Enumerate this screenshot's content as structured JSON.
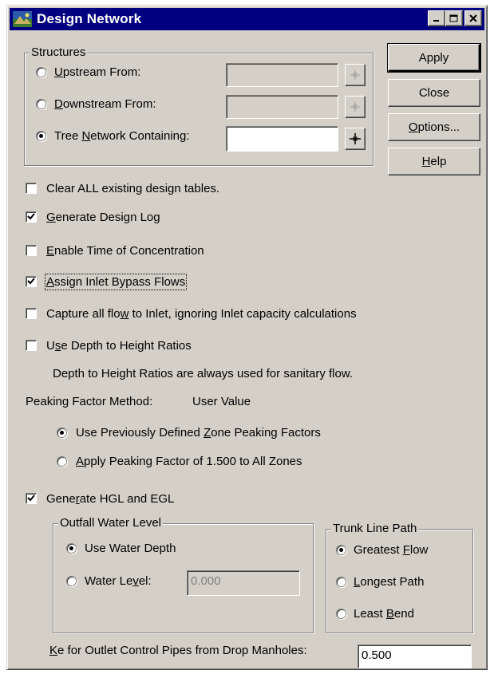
{
  "window": {
    "title": "Design Network"
  },
  "structures": {
    "group_label": "Structures",
    "upstream_label": "Upstream From:",
    "downstream_label": "Downstream From:",
    "tree_label": "Tree Network Containing:",
    "upstream_value": "",
    "downstream_value": "",
    "tree_value": "",
    "selected": "tree"
  },
  "buttons": {
    "apply": "Apply",
    "close": "Close",
    "options": "Options...",
    "help": "Help"
  },
  "options": {
    "clear_tables": {
      "label": "Clear ALL existing design tables.",
      "checked": false
    },
    "design_log": {
      "label": "Generate Design Log",
      "checked": true
    },
    "time_of_conc": {
      "label": "Enable Time of Concentration",
      "checked": false
    },
    "bypass_flows": {
      "label": "Assign Inlet Bypass Flows",
      "checked": true
    },
    "capture_flow": {
      "label": "Capture all flow to Inlet, ignoring Inlet capacity calculations",
      "checked": false
    },
    "depth_ratios": {
      "label": "Use Depth to Height Ratios",
      "checked": false
    },
    "depth_note": "Depth to Height Ratios are always used for sanitary flow."
  },
  "peaking": {
    "method_label": "Peaking Factor Method:",
    "method_value": "User Value",
    "zone_label": "Use Previously Defined Zone Peaking Factors",
    "apply_label": "Apply Peaking Factor of 1.500 to All Zones",
    "selected": "zone"
  },
  "hgl": {
    "label": "Generate HGL and EGL",
    "checked": true,
    "outfall": {
      "group_label": "Outfall Water Level",
      "depth_label": "Use Water Depth",
      "level_label": "Water Level:",
      "level_value": "0.000",
      "selected": "depth"
    },
    "trunk": {
      "group_label": "Trunk Line Path",
      "greatest": "Greatest Flow",
      "longest": "Longest Path",
      "least": "Least Bend",
      "selected": "greatest"
    },
    "ke_label": "Ke for Outlet Control Pipes from Drop Manholes:",
    "ke_value": "0.500"
  }
}
